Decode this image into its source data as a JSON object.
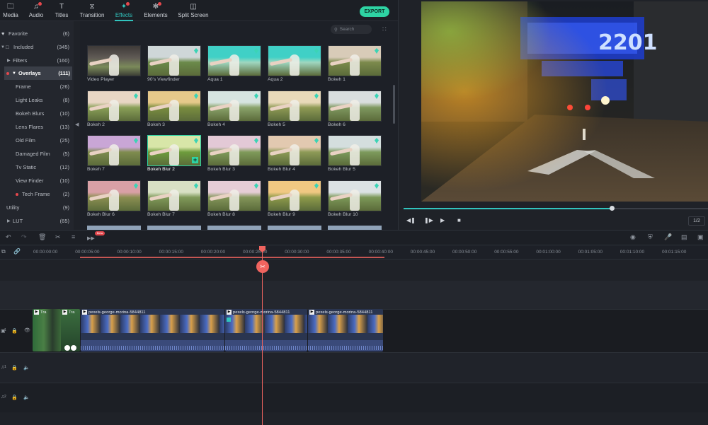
{
  "nav": {
    "tabs": [
      {
        "label": "Media",
        "icon": "folder-icon"
      },
      {
        "label": "Audio",
        "icon": "music-note-icon"
      },
      {
        "label": "Titles",
        "icon": "text-icon"
      },
      {
        "label": "Transition",
        "icon": "transition-icon"
      },
      {
        "label": "Effects",
        "icon": "effects-icon",
        "active": true
      },
      {
        "label": "Elements",
        "icon": "elements-icon"
      },
      {
        "label": "Split Screen",
        "icon": "split-screen-icon"
      }
    ],
    "export_label": "EXPORT"
  },
  "sidebar": {
    "items": [
      {
        "label": "Favorite",
        "count": "(6)"
      },
      {
        "label": "Included",
        "count": "(345)"
      },
      {
        "label": "Filters",
        "count": "(160)"
      },
      {
        "label": "Overlays",
        "count": "(111)"
      },
      {
        "label": "Frame",
        "count": "(26)"
      },
      {
        "label": "Light Leaks",
        "count": "(8)"
      },
      {
        "label": "Bokeh Blurs",
        "count": "(10)"
      },
      {
        "label": "Lens Flares",
        "count": "(13)"
      },
      {
        "label": "Old Film",
        "count": "(25)"
      },
      {
        "label": "Damaged Film",
        "count": "(5)"
      },
      {
        "label": "Tv Static",
        "count": "(12)"
      },
      {
        "label": "View Finder",
        "count": "(10)"
      },
      {
        "label": "Tech Frame",
        "count": "(2)"
      },
      {
        "label": "Utility",
        "count": "(9)"
      },
      {
        "label": "LUT",
        "count": "(65)"
      }
    ]
  },
  "search": {
    "placeholder": "Search"
  },
  "effects": [
    "Video Player",
    "90's Viewfinder",
    "Aqua 1",
    "Aqua 2",
    "Bokeh 1",
    "Bokeh 2",
    "Bokeh 3",
    "Bokeh 4",
    "Bokeh 5",
    "Bokeh 6",
    "Bokeh 7",
    "Bokeh Blur 2",
    "Bokeh Blur 3",
    "Bokeh Blur 4",
    "Bokeh Blur 5",
    "Bokeh Blur 6",
    "Bokeh Blur 7",
    "Bokeh Blur 8",
    "Bokeh Blur 9",
    "Bokeh Blur 10"
  ],
  "preview": {
    "page": "1/2",
    "progress": 0.69
  },
  "timeline": {
    "ruler": [
      "00:00:00:00",
      "00:00:05:00",
      "00:00:10:00",
      "00:00:15:00",
      "00:00:20:00",
      "00:00:25:00",
      "00:00:30:00",
      "00:00:35:00",
      "00:00:40:00",
      "00:00:45:00",
      "00:00:50:00",
      "00:00:55:00",
      "00:01:00:00",
      "00:01:05:00",
      "00:01:10:00",
      "00:01:15:00"
    ],
    "clips": [
      {
        "label": "Tra"
      },
      {
        "label": "Tra"
      },
      {
        "label": "pexels-george-morina-5844811"
      },
      {
        "label": "pexels-george-morina-5844811"
      },
      {
        "label": "pexels-george-morina-5844811"
      }
    ],
    "tracks": [
      "1",
      "1",
      "2"
    ],
    "beta_badge": "Beta"
  },
  "colors": {
    "accent": "#31c4be",
    "export": "#2ed3a3",
    "playhead": "#f0645f",
    "badge": "#e5484d"
  }
}
